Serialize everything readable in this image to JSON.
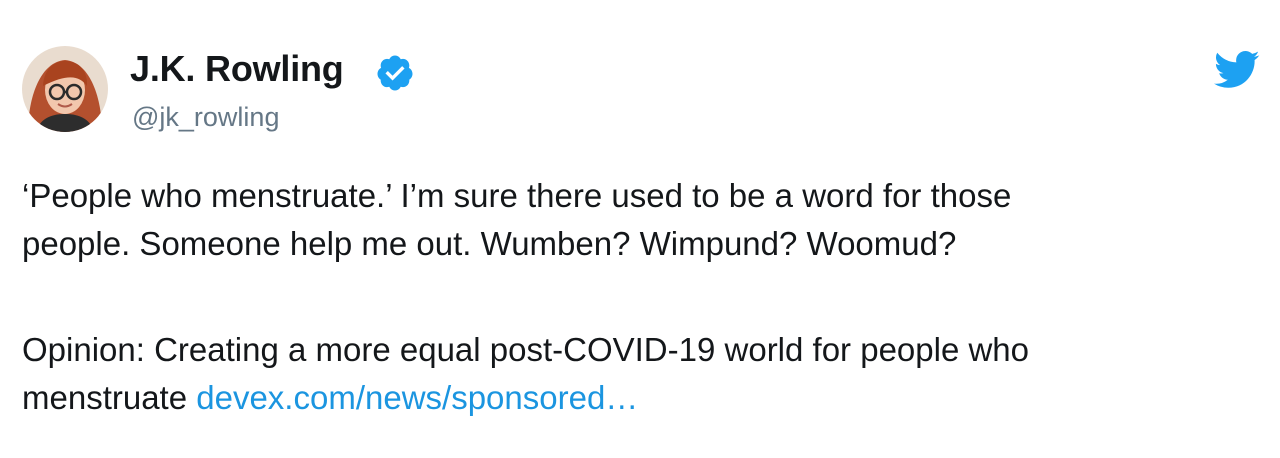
{
  "tweet": {
    "author": {
      "display_name": "J.K. Rowling",
      "handle": "@jk_rowling",
      "verified_icon": "verified-badge-icon",
      "avatar": "avatar"
    },
    "brand_icon": "twitter-bird-icon",
    "text_paragraph_1": "‘People who menstruate.’ I’m sure there used to be a word for those\npeople. Someone help me out. Wumben? Wimpund? Woomud?",
    "text_paragraph_2_prefix": "Opinion: Creating a more equal post-COVID-19 world for people who\nmenstruate ",
    "link_text": "devex.com/news/sponsored…"
  },
  "colors": {
    "text": "#14171a",
    "secondary_text": "#657786",
    "link": "#1b95e0",
    "verified": "#1da1f2",
    "brand": "#1da1f2"
  }
}
